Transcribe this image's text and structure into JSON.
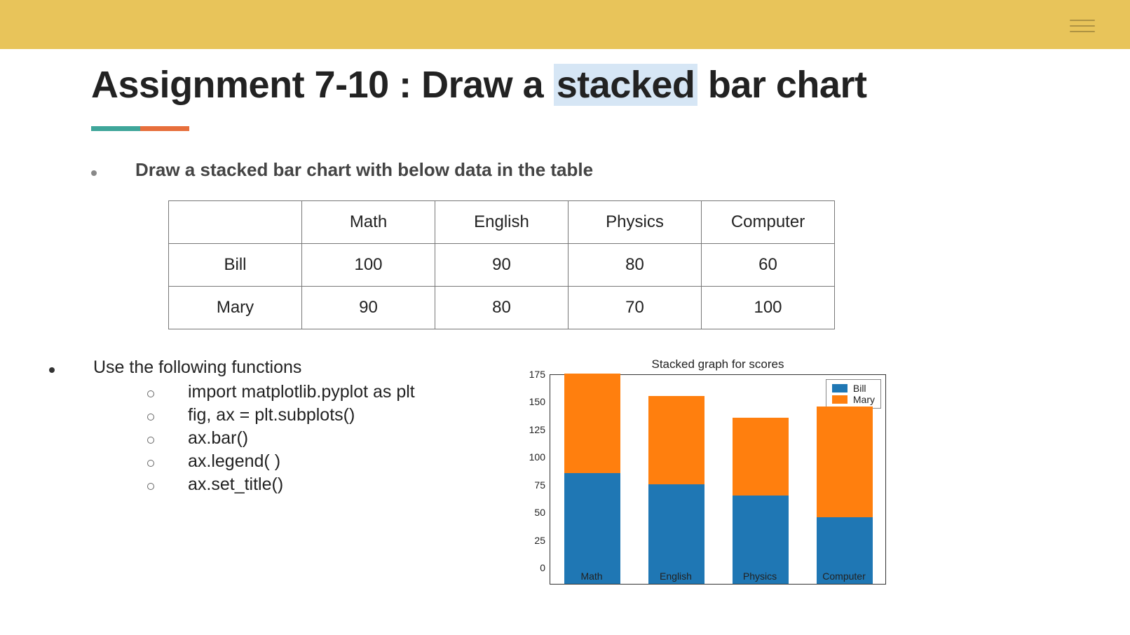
{
  "header": {
    "title_pre": "Assignment 7-10 : Draw a ",
    "title_hl": "stacked",
    "title_post": " bar chart"
  },
  "bullet1": "Draw a stacked bar chart with below data in the table",
  "table": {
    "cols": [
      "Math",
      "English",
      "Physics",
      "Computer"
    ],
    "rows": [
      {
        "name": "Bill",
        "v": [
          "100",
          "90",
          "80",
          "60"
        ]
      },
      {
        "name": "Mary",
        "v": [
          "90",
          "80",
          "70",
          "100"
        ]
      }
    ]
  },
  "bullet2": "Use the following functions",
  "funcs": [
    "import matplotlib.pyplot as plt",
    "fig, ax = plt.subplots()",
    "ax.bar()",
    "ax.legend( )",
    "ax.set_title()"
  ],
  "chart_data": {
    "type": "bar",
    "stacked": true,
    "title": "Stacked graph for scores",
    "categories": [
      "Math",
      "English",
      "Physics",
      "Computer"
    ],
    "series": [
      {
        "name": "Bill",
        "values": [
          100,
          90,
          80,
          60
        ],
        "color": "#1f77b4"
      },
      {
        "name": "Mary",
        "values": [
          90,
          80,
          70,
          100
        ],
        "color": "#ff7f0e"
      }
    ],
    "ylim": [
      0,
      190
    ],
    "yticks": [
      0,
      25,
      50,
      75,
      100,
      125,
      150,
      175
    ],
    "xlabel": "",
    "ylabel": ""
  }
}
